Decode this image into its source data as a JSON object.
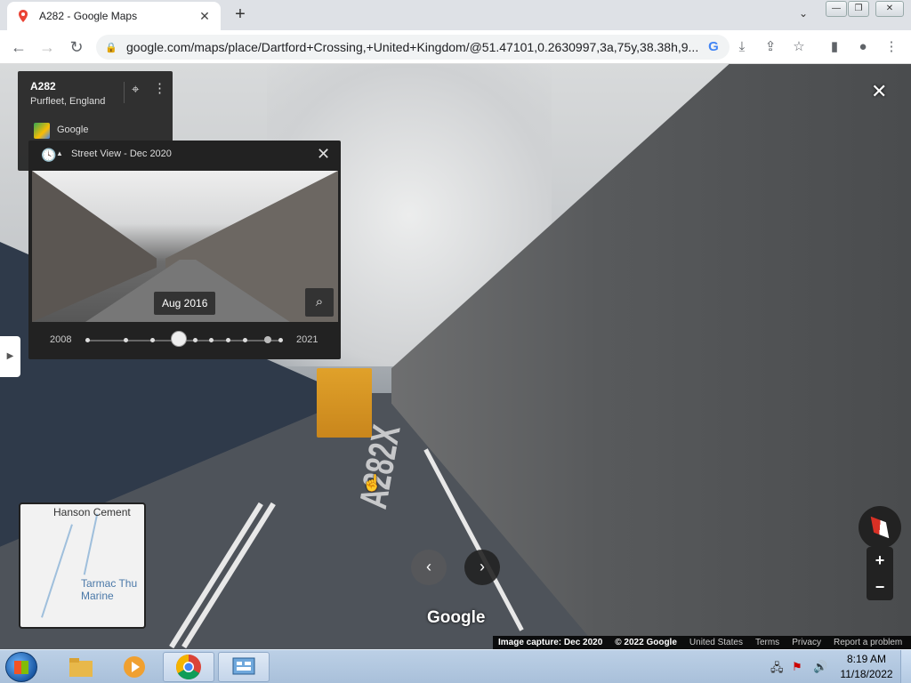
{
  "browser": {
    "tab_title": "A282 - Google Maps",
    "url": "google.com/maps/place/Dartford+Crossing,+United+Kingdom/@51.47101,0.2630997,3a,75y,38.38h,9..."
  },
  "location_card": {
    "name": "A282",
    "address": "Purfleet, England",
    "source": "Google"
  },
  "time_travel": {
    "title": "Street View - Dec 2020",
    "date_chip": "Aug 2016",
    "start_year": "2008",
    "end_year": "2021",
    "selected_position_index": 3,
    "timeline_stops": 9
  },
  "minimap": {
    "label_top": "Hanson Cement",
    "label_bottom_line1": "Tarmac Thu",
    "label_bottom_line2": "Marine"
  },
  "street_view": {
    "road_marking": "A282X",
    "watermark": "Google"
  },
  "footer": {
    "capture": "Image capture: Dec 2020",
    "copyright": "© 2022 Google",
    "region": "United States",
    "terms": "Terms",
    "privacy": "Privacy",
    "report": "Report a problem"
  },
  "taskbar": {
    "time": "8:19 AM",
    "date": "11/18/2022"
  }
}
